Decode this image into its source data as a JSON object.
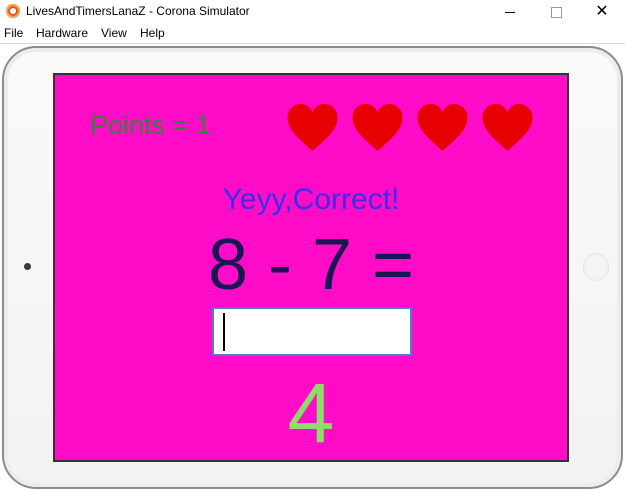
{
  "window": {
    "title": "LivesAndTimersLanaZ - Corona Simulator",
    "icon": "corona-app-icon",
    "controls": {
      "minimize": "minimize-icon",
      "maximize": "maximize-icon",
      "close_glyph": "✕"
    }
  },
  "menu": {
    "items": [
      "File",
      "Hardware",
      "View",
      "Help"
    ]
  },
  "device": {
    "model": "tablet-frame"
  },
  "game": {
    "points_text": "Points = 1",
    "lives_count": 4,
    "heart_color": "#e60000",
    "feedback_text": "Yeyy,Correct!",
    "question_text": "8 - 7 =",
    "answer_input": {
      "value": "",
      "placeholder": ""
    },
    "result_text": "4",
    "colors": {
      "background": "#ff0cc8",
      "points": "#3d7a3d",
      "feedback": "#3a2ee8",
      "question": "#1a1654",
      "result": "#8edc6a"
    }
  }
}
